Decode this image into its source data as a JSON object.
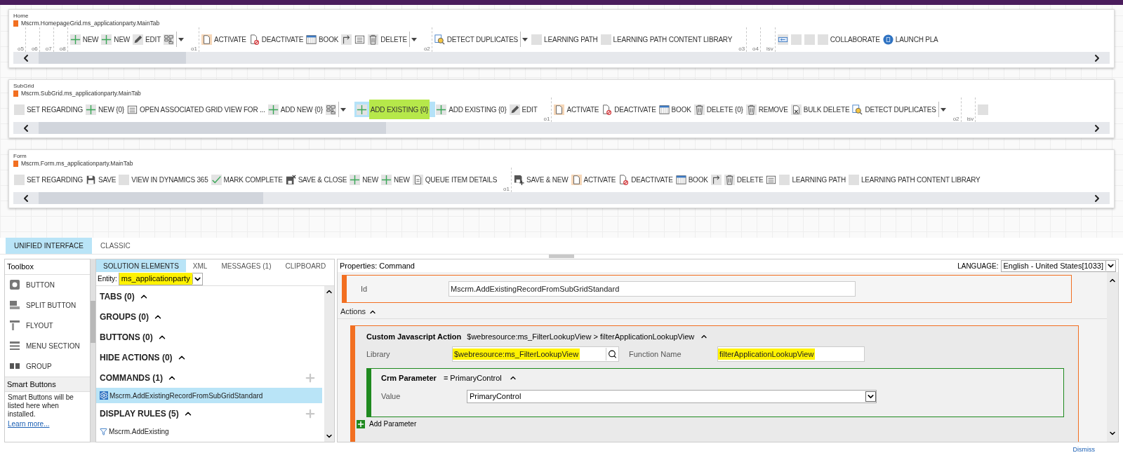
{
  "ribbons": [
    {
      "title": "Home",
      "tab_id": "Mscrm.HomepageGrid.ms_applicationparty.MainTab",
      "items": [
        {
          "kind": "group",
          "label": "o5"
        },
        {
          "kind": "group",
          "label": "o6"
        },
        {
          "kind": "group",
          "label": "o7"
        },
        {
          "kind": "group",
          "label": "o8"
        },
        {
          "kind": "plus",
          "label": "NEW"
        },
        {
          "kind": "plus",
          "label": "NEW"
        },
        {
          "kind": "edit",
          "label": "EDIT"
        },
        {
          "kind": "grid"
        },
        {
          "kind": "caret"
        },
        {
          "kind": "group",
          "label": "o1"
        },
        {
          "kind": "activate",
          "label": "ACTIVATE"
        },
        {
          "kind": "deactivate",
          "label": "DEACTIVATE"
        },
        {
          "kind": "book",
          "label": "BOOK"
        },
        {
          "kind": "flow"
        },
        {
          "kind": "form"
        },
        {
          "kind": "delete",
          "label": "DELETE"
        },
        {
          "kind": "caret"
        },
        {
          "kind": "group",
          "label": "o2"
        },
        {
          "kind": "detect",
          "label": "DETECT DUPLICATES"
        },
        {
          "kind": "caret"
        },
        {
          "kind": "blank",
          "label": "LEARNING PATH"
        },
        {
          "kind": "blank",
          "label": "LEARNING PATH CONTENT LIBRARY"
        },
        {
          "kind": "group",
          "label": "o3"
        },
        {
          "kind": "group",
          "label": "o4"
        },
        {
          "kind": "group",
          "label": "isv"
        },
        {
          "kind": "isv"
        },
        {
          "kind": "blank"
        },
        {
          "kind": "blank"
        },
        {
          "kind": "blank",
          "label": "COLLABORATE"
        },
        {
          "kind": "launch",
          "label": "LAUNCH PLA"
        }
      ]
    },
    {
      "title": "SubGrid",
      "tab_id": "Mscrm.SubGrid.ms_applicationparty.MainTab",
      "items": [
        {
          "kind": "blank",
          "label": "SET REGARDING"
        },
        {
          "kind": "plus",
          "label": "NEW {0}"
        },
        {
          "kind": "form",
          "label": "OPEN ASSOCIATED GRID VIEW FOR ..."
        },
        {
          "kind": "plus",
          "label": "ADD NEW {0}"
        },
        {
          "kind": "grid"
        },
        {
          "kind": "caret"
        },
        {
          "kind": "highlighted",
          "label": "ADD EXISTING {0}"
        },
        {
          "kind": "plus",
          "label": "ADD EXISTING {0}"
        },
        {
          "kind": "edit",
          "label": "EDIT"
        },
        {
          "kind": "group",
          "label": "o1"
        },
        {
          "kind": "activate",
          "label": "ACTIVATE"
        },
        {
          "kind": "deactivate",
          "label": "DEACTIVATE"
        },
        {
          "kind": "book",
          "label": "BOOK"
        },
        {
          "kind": "delete",
          "label": "DELETE {0}"
        },
        {
          "kind": "delete",
          "label": "REMOVE"
        },
        {
          "kind": "bulkdelete",
          "label": "BULK DELETE"
        },
        {
          "kind": "detect",
          "label": "DETECT DUPLICATES"
        },
        {
          "kind": "caret"
        },
        {
          "kind": "group",
          "label": "o2"
        },
        {
          "kind": "group",
          "label": "isv"
        },
        {
          "kind": "blank"
        }
      ]
    },
    {
      "title": "Form",
      "tab_id": "Mscrm.Form.ms_applicationparty.MainTab",
      "items": [
        {
          "kind": "blank",
          "label": "SET REGARDING"
        },
        {
          "kind": "save",
          "label": "SAVE"
        },
        {
          "kind": "blank",
          "label": "VIEW IN DYNAMICS 365"
        },
        {
          "kind": "check",
          "label": "MARK COMPLETE"
        },
        {
          "kind": "saveclose",
          "label": "SAVE & CLOSE"
        },
        {
          "kind": "plus",
          "label": "NEW"
        },
        {
          "kind": "plus",
          "label": "NEW"
        },
        {
          "kind": "queue",
          "label": "QUEUE ITEM DETAILS"
        },
        {
          "kind": "group",
          "label": "o1"
        },
        {
          "kind": "savenew",
          "label": "SAVE & NEW"
        },
        {
          "kind": "activate",
          "label": "ACTIVATE"
        },
        {
          "kind": "deactivate",
          "label": "DEACTIVATE"
        },
        {
          "kind": "book",
          "label": "BOOK"
        },
        {
          "kind": "flow"
        },
        {
          "kind": "delete",
          "label": "DELETE"
        },
        {
          "kind": "form"
        },
        {
          "kind": "blank",
          "label": "LEARNING PATH"
        },
        {
          "kind": "blank",
          "label": "LEARNING PATH CONTENT LIBRARY"
        }
      ]
    }
  ],
  "view_tabs": [
    {
      "label": "UNIFIED INTERFACE",
      "selected": true
    },
    {
      "label": "CLASSIC",
      "selected": false
    }
  ],
  "toolbox": {
    "title": "Toolbox",
    "items": [
      {
        "kind": "button",
        "label": "BUTTON"
      },
      {
        "kind": "split",
        "label": "SPLIT BUTTON"
      },
      {
        "kind": "flyout",
        "label": "FLYOUT"
      },
      {
        "kind": "menu",
        "label": "MENU SECTION"
      },
      {
        "kind": "group",
        "label": "GROUP"
      }
    ],
    "smart_title": "Smart Buttons",
    "smart_text": "Smart Buttons will be listed here when installed.",
    "smart_link": "Learn more..."
  },
  "solution": {
    "tabs": [
      {
        "label": "SOLUTION ELEMENTS",
        "selected": true
      },
      {
        "label": "XML",
        "selected": false
      },
      {
        "label": "MESSAGES (1)",
        "selected": false
      },
      {
        "label": "CLIPBOARD",
        "selected": false
      }
    ],
    "entity": {
      "label": "Entity:",
      "value": "ms_applicationparty",
      "highlighted": true
    },
    "sections": [
      {
        "label": "TABS (0)",
        "addable": false
      },
      {
        "label": "GROUPS (0)",
        "addable": false
      },
      {
        "label": "BUTTONS (0)",
        "addable": false
      },
      {
        "label": "HIDE ACTIONS (0)",
        "addable": false
      },
      {
        "label": "COMMANDS (1)",
        "addable": true,
        "items": [
          {
            "kind": "command",
            "label": "Mscrm.AddExistingRecordFromSubGridStandard",
            "selected": true
          }
        ]
      },
      {
        "label": "DISPLAY RULES (5)",
        "addable": true,
        "items": [
          {
            "kind": "rule",
            "label": "Mscrm.AddExisting",
            "selected": false
          }
        ]
      }
    ]
  },
  "properties": {
    "title": "Properties: Command",
    "language": {
      "label": "LANGUAGE:",
      "value": "English - United States[1033]"
    },
    "id": {
      "label": "Id",
      "value": "Mscrm.AddExistingRecordFromSubGridStandard"
    },
    "actions_label": "Actions",
    "action": {
      "title": "Custom Javascript Action",
      "summary": "$webresource:ms_FilterLookupView > filterApplicationLookupView",
      "library": {
        "label": "Library",
        "value": "$webresource:ms_FilterLookupView",
        "highlighted": true
      },
      "function": {
        "label": "Function Name",
        "value": "filterApplicationLookupView",
        "highlighted": true
      },
      "parameter": {
        "title": "Crm Parameter",
        "summary": "= PrimaryControl",
        "value_label": "Value",
        "value": "PrimaryControl"
      },
      "add_label": "Add Parameter"
    }
  },
  "footer": {
    "dismiss": "Dismiss"
  }
}
